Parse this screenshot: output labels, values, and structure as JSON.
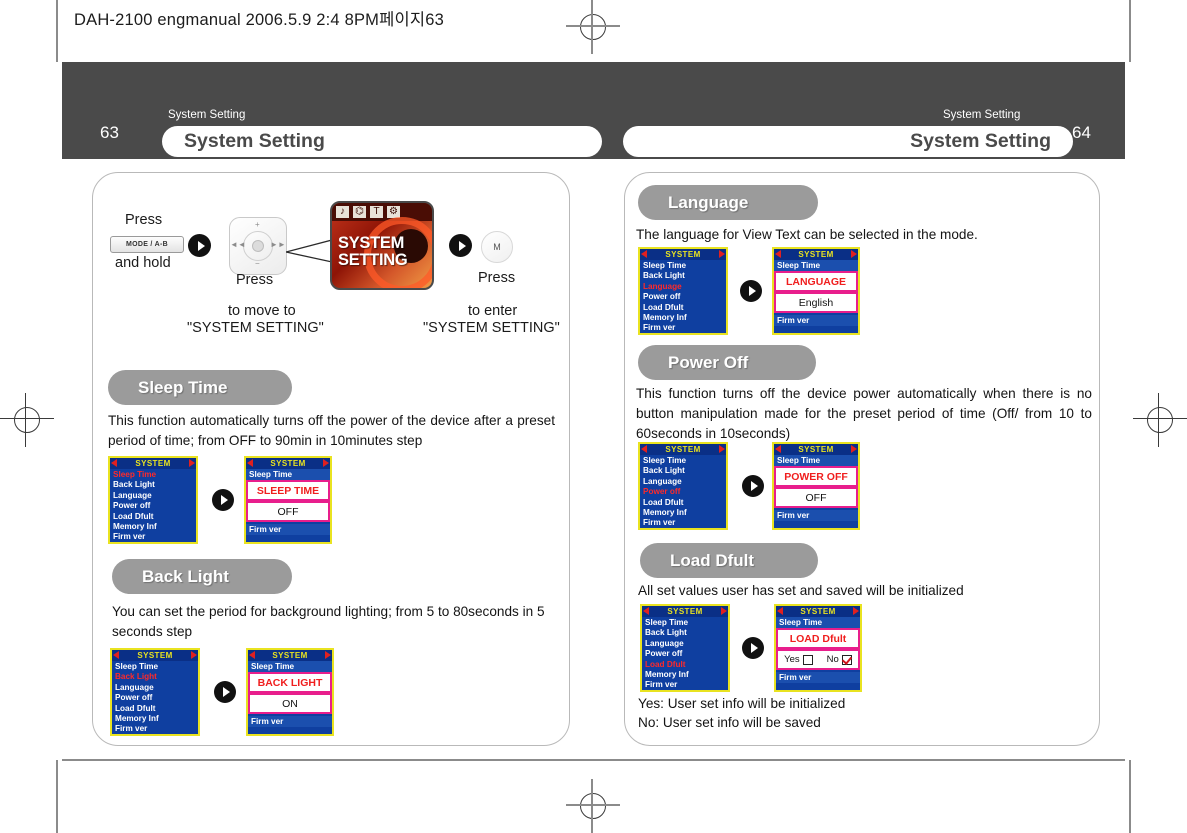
{
  "slug": "DAH-2100 engmanual  2006.5.9 2:4 8PM페이지63",
  "left_page": {
    "number": "63",
    "kicker": "System Setting",
    "title": "System Setting"
  },
  "right_page": {
    "number": "64",
    "kicker": "System Setting",
    "title": "System Setting"
  },
  "flow": {
    "press1": "Press",
    "mode_button": "MODE / A-B",
    "and_hold": "and hold",
    "press2": "Press",
    "move_to": "to move to",
    "move_target": "\"SYSTEM SETTING\"",
    "press3": "Press",
    "m_button": "M",
    "enter": "to enter",
    "enter_target": "\"SYSTEM SETTING\"",
    "thumb_line1": "SYSTEM",
    "thumb_line2": "SETTING",
    "navpad_plus": "+",
    "navpad_minus": "−",
    "navpad_prev": "◄◄",
    "navpad_next": "►►",
    "navpad_center": "❙❙"
  },
  "menu": {
    "header": "SYSTEM",
    "items": [
      "Sleep Time",
      "Back Light",
      "Language",
      "Power off",
      "Load Dfult",
      "Memory Inf",
      "Firm ver"
    ],
    "first_row": "Sleep Time",
    "last_row": "Firm ver"
  },
  "sections": [
    {
      "id": "sleep-time",
      "title": "Sleep Time",
      "body": "This function automatically turns off the power of the device after a preset period of time; from OFF to 90min in 10minutes step",
      "selected_index": 0,
      "label": "SLEEP TIME",
      "value": "OFF"
    },
    {
      "id": "back-light",
      "title": "Back Light",
      "body": "You can set the period for background lighting; from 5 to 80seconds in 5 seconds step",
      "selected_index": 1,
      "label": "BACK LIGHT",
      "value": "ON"
    },
    {
      "id": "language",
      "title": "Language",
      "body": "The language for View Text can be selected in the mode.",
      "selected_index": 2,
      "label": "LANGUAGE",
      "value": "English"
    },
    {
      "id": "power-off",
      "title": "Power Off",
      "body": "This function turns off the device power automatically when there is no button manipulation made for the preset period of time (Off/ from 10 to 60seconds in 10seconds)",
      "selected_index": 3,
      "label": "POWER OFF",
      "value": "OFF"
    },
    {
      "id": "load-dfult",
      "title": "Load Dfult",
      "body": "All set values user has set and saved will be initialized",
      "selected_index": 4,
      "label": "LOAD Dfult",
      "yes_label": "Yes",
      "no_label": "No",
      "footnote1": "Yes: User set info will be initialized",
      "footnote2": "No: User set info will be saved"
    }
  ],
  "colors": {
    "header_band": "#4a4a4a",
    "pill": "#9b9b9b",
    "lcd_bg": "#0f3fa0",
    "lcd_border": "#e9e320",
    "lcd_title": "#e9e320",
    "lcd_selected": "#ff2a2a",
    "highlight_border": "#e81e8c",
    "highlight_text": "#f01e1e"
  }
}
